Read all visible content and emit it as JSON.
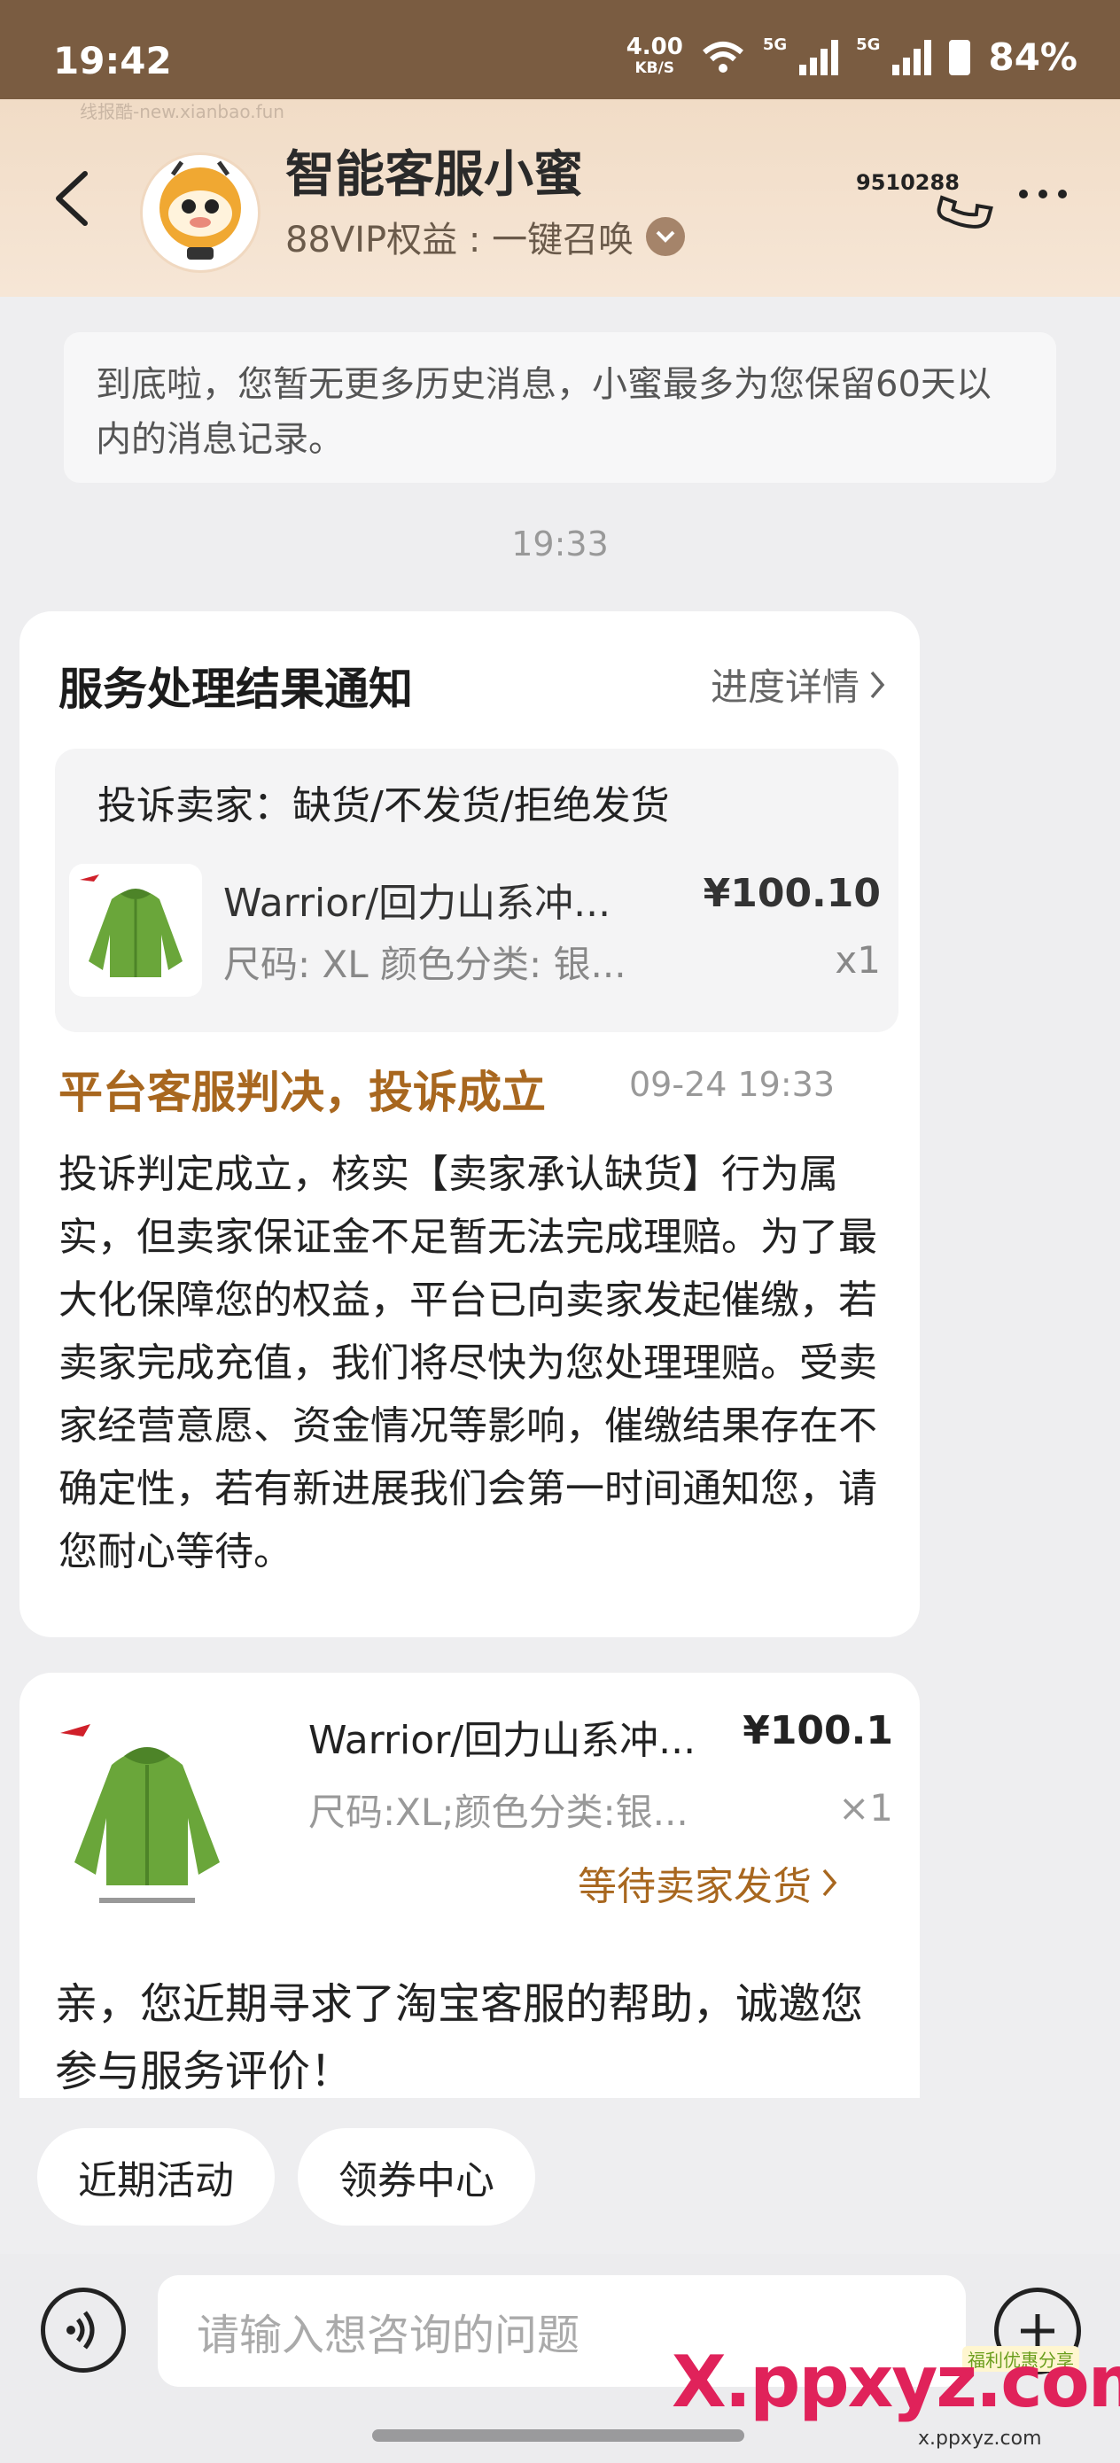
{
  "status_bar": {
    "time": "19:42",
    "net_speed": "4.00",
    "net_unit": "KB/S",
    "sig1": "5G",
    "sig2": "5G",
    "battery": "84%"
  },
  "header": {
    "watermark": "线报酷-new.xianbao.fun",
    "title": "智能客服小蜜",
    "subtitle": "88VIP权益 : 一键召唤",
    "phone_number": "9510288"
  },
  "notice": "到底啦，您暂无更多历史消息，小蜜最多为您保留60天以内的消息记录。",
  "timestamp": "19:33",
  "result_card": {
    "title": "服务处理结果通知",
    "link": "进度详情",
    "complaint": "投诉卖家：缺货/不发货/拒绝发货",
    "product_name": "Warrior/回力山系冲...",
    "product_spec": "尺码: XL 颜色分类: 银...",
    "price": "¥100.10",
    "qty": "x1",
    "verdict": "平台客服判决，投诉成立",
    "verdict_time": "09-24 19:33",
    "body": "投诉判定成立，核实【卖家承认缺货】行为属实，但卖家保证金不足暂无法完成理赔。为了最大化保障您的权益，平台已向卖家发起催缴，若卖家完成充值，我们将尽快为您处理理赔。受卖家经营意愿、资金情况等影响，催缴结果存在不确定性，若有新进展我们会第一时间通知您，请您耐心等待。"
  },
  "order_card": {
    "product_name": "Warrior/回力山系冲...",
    "product_spec": "尺码:XL;颜色分类:银...",
    "price": "¥100.1",
    "qty": "×1",
    "status": "等待卖家发货",
    "body": "亲，您近期寻求了淘宝客服的帮助，诚邀您参与服务评价！"
  },
  "chips": [
    "近期活动",
    "领券中心"
  ],
  "input": {
    "placeholder": "请输入想咨询的问题"
  },
  "footer_watermark": {
    "main": "X.ppxyz.com",
    "sub": "x.ppxyz.com",
    "badge": "福利优惠分享"
  },
  "colors": {
    "accent_brown": "#a8671f",
    "header_bar": "#7a5c41"
  },
  "icons": [
    "back-arrow-icon",
    "mascot-avatar",
    "chevron-down-icon",
    "phone-icon",
    "more-icon",
    "chevron-right-icon",
    "voice-icon",
    "plus-icon"
  ]
}
